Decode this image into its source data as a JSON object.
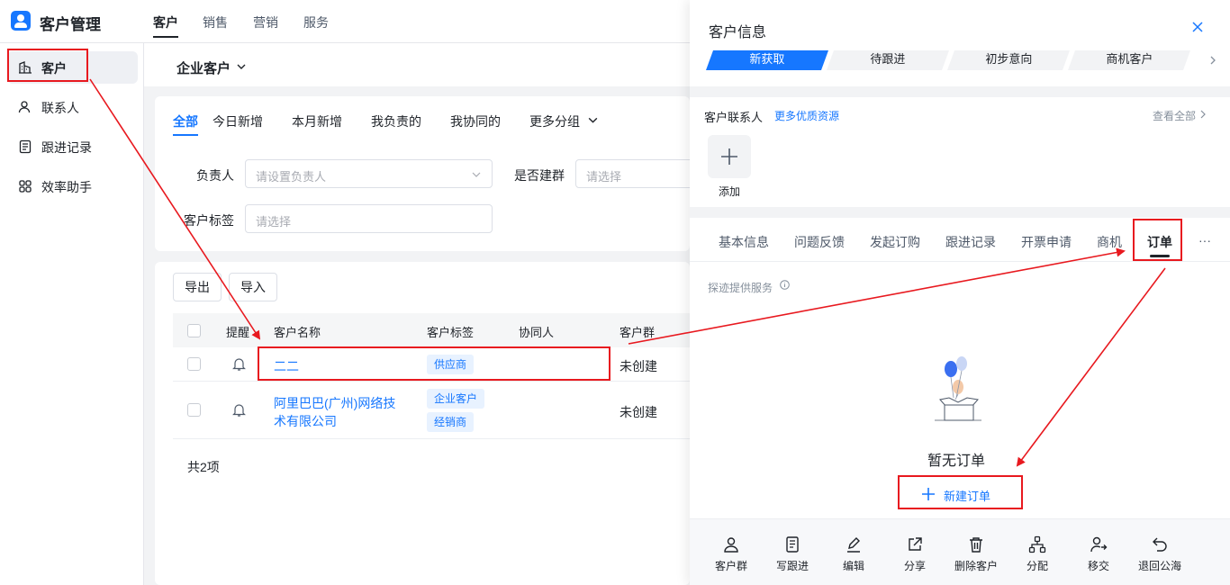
{
  "app": {
    "title": "客户管理"
  },
  "topnav": [
    "客户",
    "销售",
    "营销",
    "服务"
  ],
  "sidebar": {
    "items": [
      {
        "label": "客户",
        "icon": "building-icon"
      },
      {
        "label": "联系人",
        "icon": "user-icon"
      },
      {
        "label": "跟进记录",
        "icon": "notes-icon"
      },
      {
        "label": "效率助手",
        "icon": "apps-icon"
      }
    ]
  },
  "main": {
    "view_title": "企业客户",
    "tabs": [
      "全部",
      "今日新增",
      "本月新增",
      "我负责的",
      "我协同的",
      "更多分组"
    ],
    "filters": {
      "owner_label": "负责人",
      "owner_placeholder": "请设置负责人",
      "group_label": "是否建群",
      "group_placeholder": "请选择",
      "tag_label": "客户标签",
      "tag_placeholder": "请选择"
    },
    "buttons": {
      "export": "导出",
      "import": "导入"
    },
    "table": {
      "columns": [
        "提醒",
        "客户名称",
        "客户标签",
        "协同人",
        "客户群"
      ],
      "rows": [
        {
          "name": "二二",
          "tags": [
            "供应商"
          ],
          "group": "未创建"
        },
        {
          "name_line1": "阿里巴巴(广州)网络技",
          "name_line2": "术有限公司",
          "tags": [
            "企业客户",
            "经销商"
          ],
          "group": "未创建"
        }
      ],
      "total": "共2项"
    }
  },
  "drawer": {
    "title": "客户信息",
    "stages": [
      "新获取",
      "待跟进",
      "初步意向",
      "商机客户"
    ],
    "contacts": {
      "title": "客户联系人",
      "more_link": "更多优质资源",
      "view_all": "查看全部",
      "add_label": "添加"
    },
    "tabs": [
      "基本信息",
      "问题反馈",
      "发起订购",
      "跟进记录",
      "开票申请",
      "商机",
      "订单",
      "···"
    ],
    "service_note": "探迹提供服务",
    "empty_text": "暂无订单",
    "new_order": "新建订单",
    "actions": [
      {
        "label": "客户群",
        "icon": "user-group-icon"
      },
      {
        "label": "写跟进",
        "icon": "document-icon"
      },
      {
        "label": "编辑",
        "icon": "pen-icon"
      },
      {
        "label": "分享",
        "icon": "share-icon"
      },
      {
        "label": "删除客户",
        "icon": "trash-icon"
      },
      {
        "label": "分配",
        "icon": "hierarchy-icon"
      },
      {
        "label": "移交",
        "icon": "transfer-user-icon"
      },
      {
        "label": "退回公海",
        "icon": "return-icon"
      }
    ]
  },
  "colors": {
    "accent": "#1677ff",
    "annotation": "#e8191f"
  }
}
